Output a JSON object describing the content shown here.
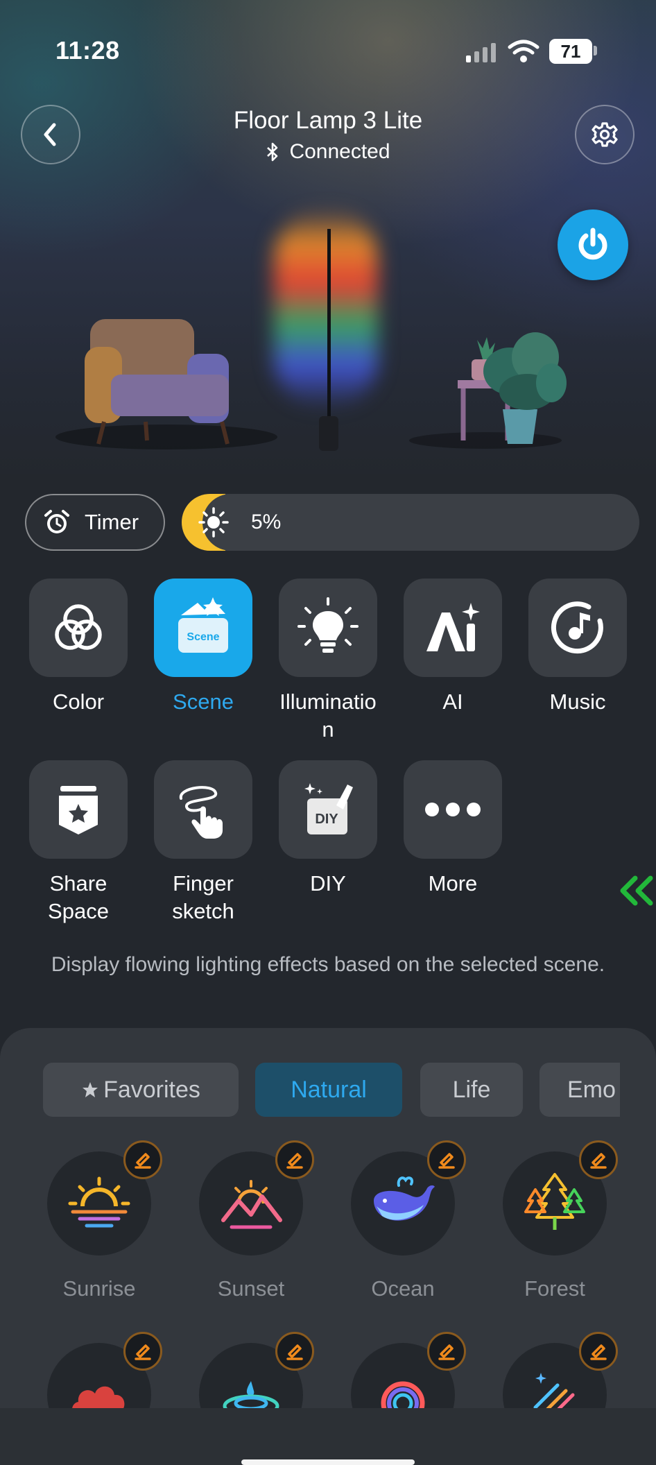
{
  "status_bar": {
    "time": "11:28",
    "battery": "71"
  },
  "header": {
    "title": "Floor Lamp 3 Lite",
    "connection": "Connected"
  },
  "timer": {
    "label": "Timer"
  },
  "brightness": {
    "value": "5%",
    "level": 0.05
  },
  "modes": [
    {
      "label": "Color",
      "icon": "color-circles-icon",
      "active": false
    },
    {
      "label": "Scene",
      "icon": "scene-icon",
      "active": true,
      "icon_text": "Scene"
    },
    {
      "label": "Illuminatio n",
      "icon": "bulb-icon",
      "active": false
    },
    {
      "label": "AI",
      "icon": "ai-icon",
      "active": false
    },
    {
      "label": "Music",
      "icon": "music-icon",
      "active": false
    },
    {
      "label": "Share Space",
      "icon": "share-space-icon",
      "active": false
    },
    {
      "label": "Finger sketch",
      "icon": "finger-sketch-icon",
      "active": false
    },
    {
      "label": "DIY",
      "icon": "diy-icon",
      "active": false,
      "icon_text": "DIY"
    },
    {
      "label": "More",
      "icon": "more-icon",
      "active": false
    }
  ],
  "description": "Display flowing lighting effects based on the selected scene.",
  "categories": [
    {
      "label": "Favorites",
      "active": false
    },
    {
      "label": "Natural",
      "active": true
    },
    {
      "label": "Life",
      "active": false
    },
    {
      "label": "Emo",
      "active": false
    }
  ],
  "scenes": [
    {
      "label": "Sunrise",
      "icon": "sunrise-icon"
    },
    {
      "label": "Sunset",
      "icon": "sunset-icon"
    },
    {
      "label": "Ocean",
      "icon": "whale-icon"
    },
    {
      "label": "Forest",
      "icon": "forest-icon"
    },
    {
      "label": "",
      "icon": "cloud-icon"
    },
    {
      "label": "",
      "icon": "water-drop-icon"
    },
    {
      "label": "",
      "icon": "rainbow-ring-icon"
    },
    {
      "label": "",
      "icon": "meteor-icon"
    }
  ],
  "colors": {
    "accent": "#19a8ea",
    "brightness": "#f6c12f",
    "edit_badge": "#f08a1c"
  }
}
